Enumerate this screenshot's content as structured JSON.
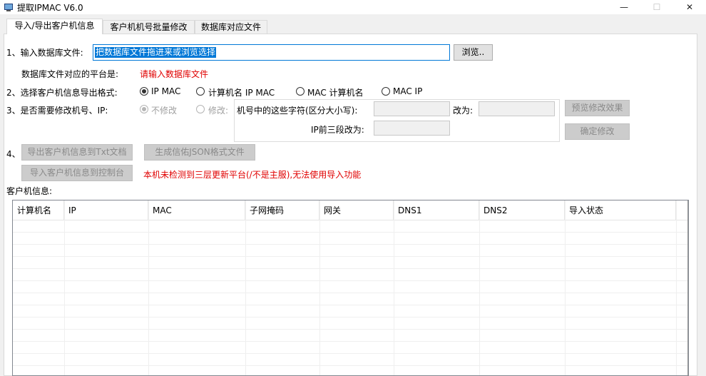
{
  "window": {
    "title": "提取IPMAC V6.0",
    "minimize": "—",
    "maximize": "☐",
    "close": "✕"
  },
  "tabs": [
    {
      "label": "导入/导出客户机信息",
      "active": true
    },
    {
      "label": "客户机机号批量修改",
      "active": false
    },
    {
      "label": "数据库对应文件",
      "active": false
    }
  ],
  "step1": {
    "label": "1、输入数据库文件:",
    "input_value": "把数据库文件拖进来或浏览选择",
    "browse_button": "浏览..",
    "platform_label": "数据库文件对应的平台是:",
    "platform_value": "请输入数据库文件"
  },
  "step2": {
    "label": "2、选择客户机信息导出格式:",
    "options": [
      "IP MAC",
      "计算机名 IP MAC",
      "MAC 计算机名",
      "MAC IP"
    ],
    "selected": "IP MAC"
  },
  "step3": {
    "label": "3、是否需要修改机号、IP:",
    "no_change": "不修改",
    "change": "修改:",
    "chars_label": "机号中的这些字符(区分大小写):",
    "change_to_label": "改为:",
    "ip_prefix_label": "IP前三段改为:",
    "preview_button": "预览修改效果",
    "confirm_button": "确定修改"
  },
  "step4": {
    "label": "4、",
    "export_txt_button": "导出客户机信息到Txt文档",
    "gen_json_button": "生成信佑JSON格式文件",
    "import_console_button": "导入客户机信息到控制台",
    "warning": "本机未检测到三层更新平台(/不是主服),无法使用导入功能"
  },
  "client_info": {
    "label": "客户机信息:",
    "columns": [
      "计算机名",
      "IP",
      "MAC",
      "子网掩码",
      "网关",
      "DNS1",
      "DNS2",
      "导入状态"
    ],
    "rows": []
  }
}
